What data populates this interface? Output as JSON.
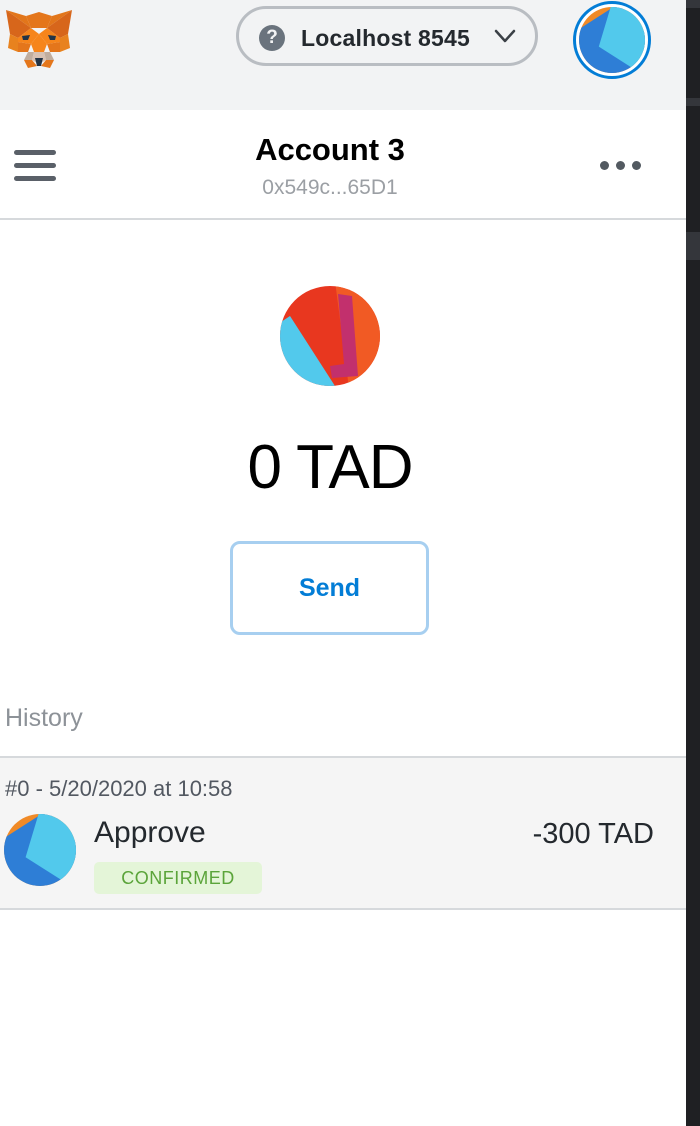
{
  "header": {
    "network": {
      "label": "Localhost 8545",
      "help_glyph": "?",
      "icon": "question-circle-icon",
      "chevron_icon": "chevron-down-icon"
    },
    "logo_icon": "metamask-fox-icon",
    "account_avatar_icon": "jazzicon"
  },
  "account": {
    "name": "Account 3",
    "address": "0x549c...65D1",
    "menu_icon": "hamburger-menu-icon",
    "options_icon": "kebab-menu-icon"
  },
  "token": {
    "balance": "0 TAD",
    "icon": "token-jazzicon",
    "send_label": "Send"
  },
  "history": {
    "title": "History",
    "transactions": [
      {
        "date": "#0 - 5/20/2020 at 10:58",
        "action": "Approve",
        "status": "CONFIRMED",
        "amount": "-300 TAD"
      }
    ]
  },
  "colors": {
    "accent": "#037dd6",
    "header_bg": "#f2f3f4",
    "confirmed_text": "#5ba43a",
    "confirmed_bg": "#e4f5d8"
  }
}
